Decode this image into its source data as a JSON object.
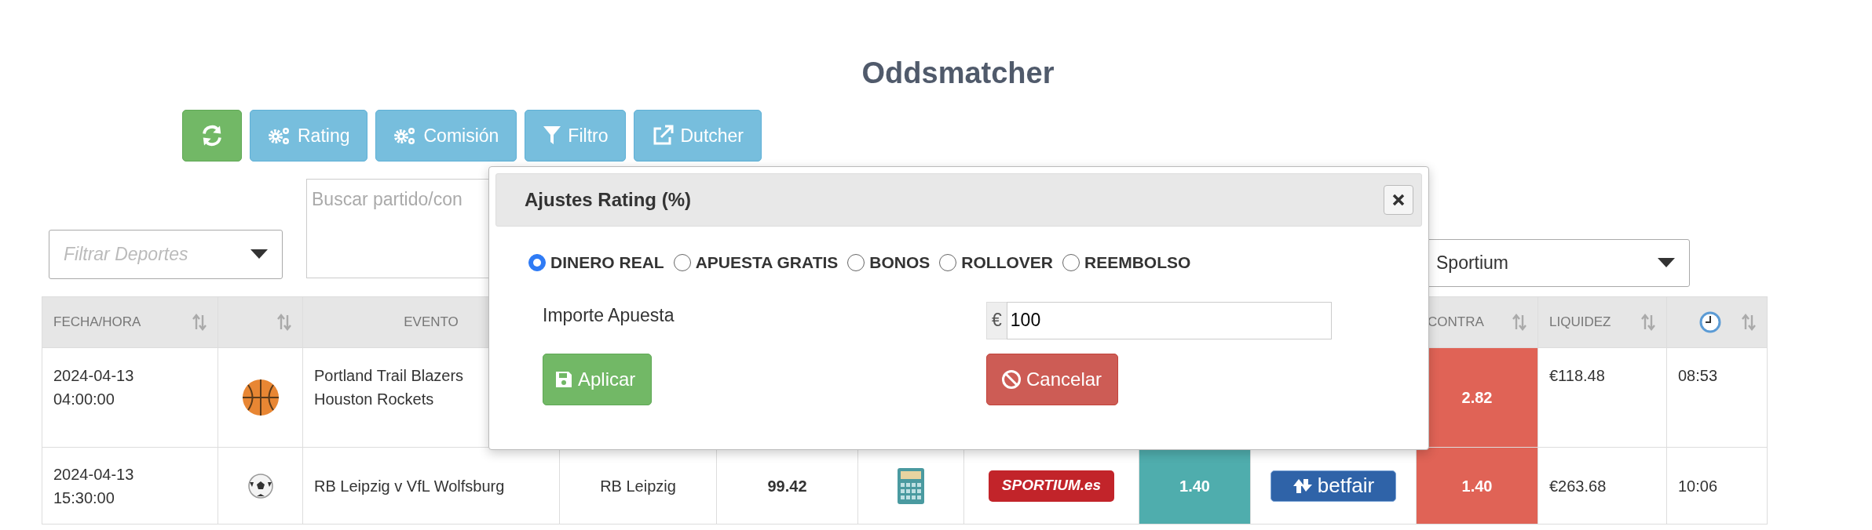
{
  "title": "Oddsmatcher",
  "toolbar": [
    {
      "kind": "refresh"
    },
    {
      "kind": "gears",
      "label": "Rating"
    },
    {
      "kind": "gears",
      "label": "Comisión"
    },
    {
      "kind": "filter",
      "label": "Filtro"
    },
    {
      "kind": "external",
      "label": "Dutcher"
    }
  ],
  "sport_filter": {
    "placeholder": "Filtrar Deportes"
  },
  "search": {
    "placeholder": "Buscar partido/con"
  },
  "bookmaker_filter": {
    "value": "Sportium"
  },
  "table": {
    "headers": {
      "datetime": {
        "label": "FECHA/HORA",
        "sortable": true
      },
      "sport": {
        "sortable": true
      },
      "event": {
        "label": "EVENTO",
        "sortable": false
      },
      "lay": {
        "label": "CONTRA",
        "sortable": true
      },
      "liquidity": {
        "label": "LIQUIDEZ",
        "sortable": true
      },
      "time": {
        "kind": "clock",
        "sortable": true
      }
    },
    "rows": [
      {
        "datetime": "2024-04-13\n04:00:00",
        "sport": {
          "kind": "basketball"
        },
        "event": "Portland Trail Blazers\nHouston Rockets",
        "lay": "2.82",
        "liquidity": "€118.48",
        "time": "08:53"
      },
      {
        "datetime": "2024-04-13\n15:30:00",
        "sport": {
          "kind": "soccer"
        },
        "event": "RB Leipzig v VfL Wolfsburg",
        "selection": "RB Leipzig",
        "rating": "99.42",
        "calculator": true,
        "bookmaker": {
          "kind": "sportium",
          "name": "SPORTIUM.es"
        },
        "back": "1.40",
        "exchange": {
          "kind": "betfair",
          "name": "betfair"
        },
        "lay": "1.40",
        "liquidity": "€263.68",
        "time": "10:06"
      }
    ]
  },
  "modal": {
    "title": "Ajustes Rating (%)",
    "modes": [
      {
        "label": "DINERO REAL",
        "selected": true
      },
      {
        "label": "APUESTA GRATIS",
        "selected": false
      },
      {
        "label": "BONOS",
        "selected": false
      },
      {
        "label": "ROLLOVER",
        "selected": false
      },
      {
        "label": "REEMBOLSO",
        "selected": false
      }
    ],
    "stake": {
      "label": "Importe Apuesta",
      "currency": "€",
      "value": "100"
    },
    "buttons": [
      {
        "kind": "apply",
        "label": "Aplicar"
      },
      {
        "kind": "cancel",
        "label": "Cancelar"
      }
    ]
  }
}
